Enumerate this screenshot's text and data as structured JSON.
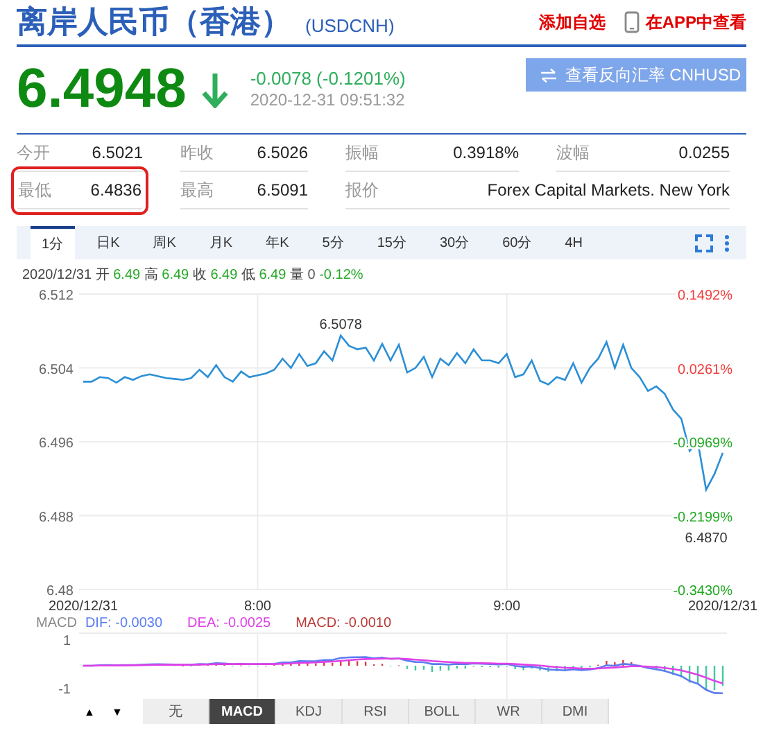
{
  "header": {
    "title": "离岸人民币（香港）",
    "code": "(USDCNH)",
    "watchlist_link": "添加自选",
    "app_link": "在APP中查看"
  },
  "quote": {
    "price": "6.4948",
    "falling": true,
    "change": "-0.0078 (-0.1201%)",
    "time": "2020-12-31 09:51:32",
    "reverse_button": "查看反向汇率 CNHUSD"
  },
  "stats": [
    [
      {
        "label": "今开",
        "value": "6.5021",
        "highlighted": false
      },
      {
        "label": "昨收",
        "value": "6.5026",
        "highlighted": false
      },
      {
        "label": "振幅",
        "value": "0.3918%",
        "highlighted": false
      },
      {
        "label": "波幅",
        "value": "0.0255",
        "highlighted": false
      }
    ],
    [
      {
        "label": "最低",
        "value": "6.4836",
        "highlighted": true
      },
      {
        "label": "最高",
        "value": "6.5091",
        "highlighted": false
      },
      {
        "label": "报价",
        "value": "Forex Capital Markets. New York",
        "highlighted": false
      }
    ]
  ],
  "period_tabs": [
    {
      "label": "1分",
      "selected": true
    },
    {
      "label": "日K",
      "selected": false
    },
    {
      "label": "周K",
      "selected": false
    },
    {
      "label": "月K",
      "selected": false
    },
    {
      "label": "年K",
      "selected": false
    },
    {
      "label": "5分",
      "selected": false
    },
    {
      "label": "15分",
      "selected": false
    },
    {
      "label": "30分",
      "selected": false
    },
    {
      "label": "60分",
      "selected": false
    },
    {
      "label": "4H",
      "selected": false
    }
  ],
  "bar_info": {
    "date": "2020/12/31",
    "items": [
      {
        "label": "开",
        "value": "6.49",
        "kind": "price"
      },
      {
        "label": "高",
        "value": "6.49",
        "kind": "price"
      },
      {
        "label": "收",
        "value": "6.49",
        "kind": "price"
      },
      {
        "label": "低",
        "value": "6.49",
        "kind": "price"
      },
      {
        "label": "量",
        "value": "0",
        "kind": "volume"
      }
    ],
    "change": "-0.12%"
  },
  "price_chart": {
    "chart_data": {
      "type": "line",
      "categories": [
        "2020/12/31",
        null,
        null,
        null,
        null,
        null,
        null,
        null,
        null,
        null,
        null,
        null,
        null,
        null,
        null,
        null,
        null,
        null,
        null,
        null,
        null,
        "8:00",
        null,
        null,
        null,
        null,
        null,
        null,
        null,
        null,
        null,
        null,
        null,
        null,
        null,
        null,
        null,
        null,
        null,
        null,
        null,
        null,
        null,
        null,
        null,
        null,
        null,
        null,
        null,
        null,
        null,
        "9:00",
        null,
        null,
        null,
        null,
        null,
        null,
        null,
        null,
        null,
        null,
        null,
        null,
        null,
        null,
        null,
        null,
        null,
        null,
        null,
        null,
        null,
        null,
        null,
        null,
        null,
        "2020/12/31"
      ],
      "series": [
        {
          "color": "#2b8fd6",
          "values": [
            6.5025,
            6.5025,
            6.503,
            6.5029,
            6.5024,
            6.503,
            6.5027,
            6.5031,
            6.5033,
            6.5031,
            6.5029,
            6.5028,
            6.5027,
            6.5029,
            6.5038,
            6.503,
            6.5043,
            6.503,
            6.5025,
            6.5036,
            6.503,
            6.5032,
            6.5034,
            6.5038,
            6.505,
            6.504,
            6.5055,
            6.5042,
            6.5045,
            6.5058,
            6.5048,
            6.5075,
            6.5064,
            6.506,
            6.5062,
            6.5048,
            6.5066,
            6.5048,
            6.5065,
            6.5035,
            6.504,
            6.5052,
            6.503,
            6.505,
            6.5043,
            6.5056,
            6.5045,
            6.506,
            6.5048,
            6.5048,
            6.5045,
            6.5055,
            6.503,
            6.5033,
            6.5048,
            6.5026,
            6.5022,
            6.503,
            6.5027,
            6.5045,
            6.5024,
            6.504,
            6.505,
            6.5068,
            6.504,
            6.5065,
            6.504,
            6.503,
            6.5015,
            6.502,
            6.5012,
            6.4995,
            6.4985,
            6.495,
            6.496,
            6.4908,
            6.4925,
            6.4948
          ]
        }
      ],
      "ylim": [
        6.48,
        6.512
      ],
      "yticks": [
        6.48,
        6.488,
        6.496,
        6.504,
        6.512
      ],
      "grid": true,
      "annotations": [
        "6.5078",
        "6.4870"
      ]
    },
    "right_axis": [
      {
        "label": "0.1492%",
        "color": "#f03c3c"
      },
      {
        "label": "0.0261%",
        "color": "#f03c3c"
      },
      {
        "label": "-0.0969%",
        "color": "#22a822"
      },
      {
        "label": "-0.2199%",
        "color": "#22a822"
      },
      {
        "label": "-0.3430%",
        "color": "#22a822"
      }
    ]
  },
  "macd_panel": {
    "legend_title": "MACD",
    "legend": [
      {
        "label": "DIF: -0.0030",
        "color": "#5b7cf0"
      },
      {
        "label": "DEA: -0.0025",
        "color": "#e040e8"
      },
      {
        "label": "MACD: -0.0010",
        "color": "#b83a3a"
      }
    ],
    "ticks": [
      "1",
      "-1"
    ]
  },
  "indicator_bar": {
    "arrows": [
      "▲",
      "▼"
    ],
    "tabs": [
      {
        "label": "无",
        "selected": false
      },
      {
        "label": "MACD",
        "selected": true
      },
      {
        "label": "KDJ",
        "selected": false
      },
      {
        "label": "RSI",
        "selected": false
      },
      {
        "label": "BOLL",
        "selected": false
      },
      {
        "label": "WR",
        "selected": false
      },
      {
        "label": "DMI",
        "selected": false
      }
    ]
  }
}
